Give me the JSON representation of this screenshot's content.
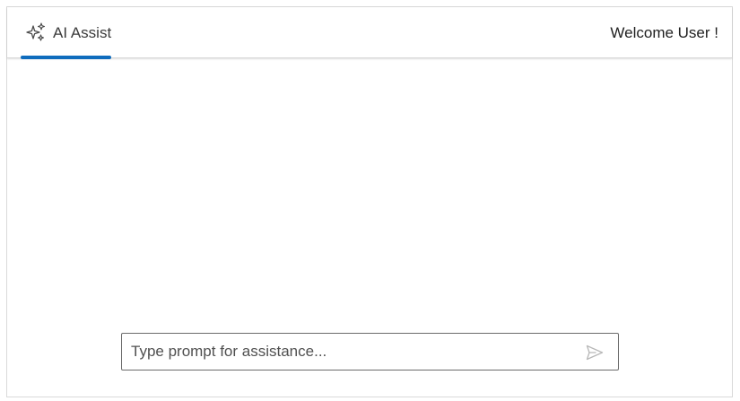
{
  "header": {
    "tab": {
      "label": "AI Assist",
      "icon": "sparkle-icon",
      "active": true,
      "accent_color": "#0f6cbd"
    },
    "welcome_text": "Welcome User !"
  },
  "prompt": {
    "placeholder": "Type prompt for assistance...",
    "value": "",
    "send_icon": "send-icon"
  }
}
